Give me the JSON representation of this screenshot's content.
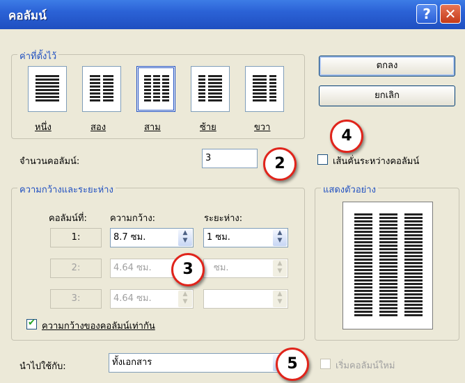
{
  "window": {
    "title": "คอลัมน์",
    "help_glyph": "?",
    "close_glyph": "✕"
  },
  "presets": {
    "legend": "ค่าที่ตั้งไว้",
    "items": [
      {
        "label": "หนึ่ง"
      },
      {
        "label": "สอง"
      },
      {
        "label": "สาม"
      },
      {
        "label": "ซ้าย"
      },
      {
        "label": "ขวา"
      }
    ],
    "selected": "สาม"
  },
  "buttons": {
    "ok": "ตกลง",
    "cancel": "ยกเลิก"
  },
  "num_columns": {
    "label": "จำนวนคอลัมน์:",
    "value": "3"
  },
  "line_between": {
    "label": "เส้นคั่นระหว่างคอลัมน์",
    "checked": false
  },
  "width_spacing": {
    "legend": "ความกว้างและระยะห่าง",
    "col_header": "คอลัมน์ที่:",
    "width_header": "ความกว้าง:",
    "spacing_header": "ระยะห่าง:",
    "rows": [
      {
        "num": "1:",
        "width": "8.7 ซม.",
        "spacing": "1 ซม.",
        "enabled": true
      },
      {
        "num": "2:",
        "width": "4.64 ซม.",
        "spacing": "ซม.",
        "enabled": false
      },
      {
        "num": "3:",
        "width": "4.64 ซม.",
        "spacing": "",
        "enabled": false
      }
    ],
    "equal_width": {
      "label": "ความกว้างของคอลัมน์เท่ากัน",
      "checked": true
    }
  },
  "preview": {
    "legend": "แสดงตัวอย่าง"
  },
  "apply_to": {
    "label": "นำไปใช้กับ:",
    "value": "ทั้งเอกสาร"
  },
  "start_new_column": {
    "label": "เริ่มคอลัมน์ใหม่",
    "checked": false,
    "enabled": false
  },
  "callouts": [
    "2",
    "3",
    "4",
    "5"
  ],
  "colors": {
    "title_bar": "#2b62d6",
    "legend_text": "#1f4fc0",
    "callout_border": "#e0241b",
    "dialog_bg": "#ece9d8"
  }
}
